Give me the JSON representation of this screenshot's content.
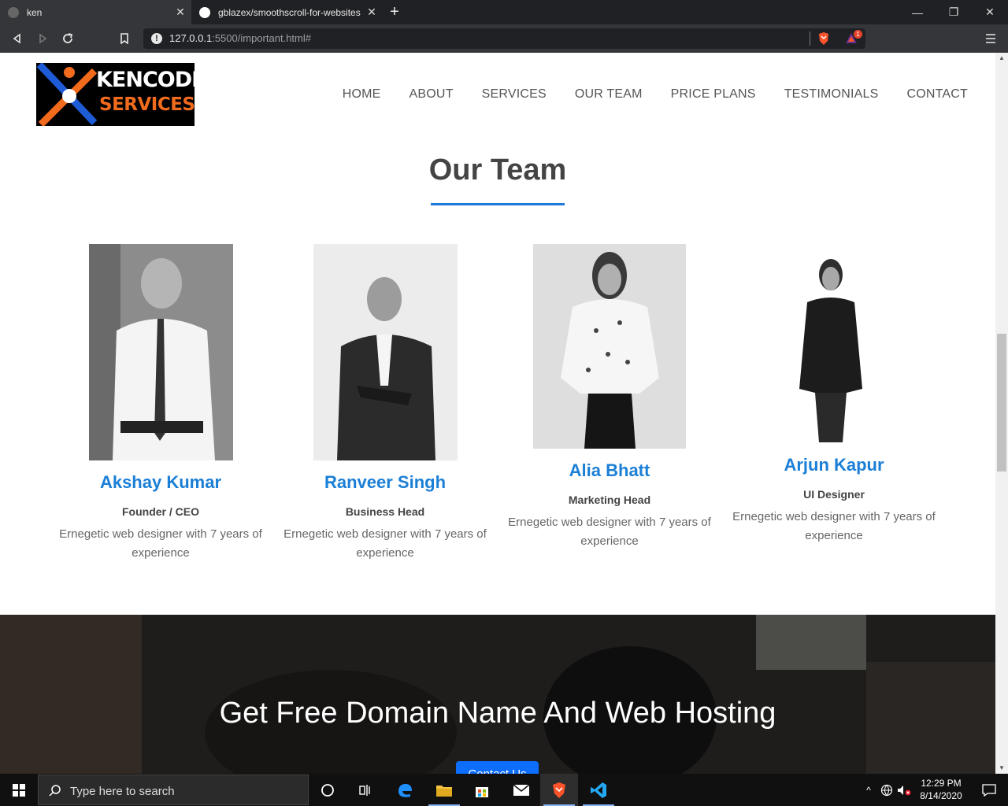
{
  "browser": {
    "tabs": [
      {
        "title": "ken",
        "active": true
      },
      {
        "title": "gblazex/smoothscroll-for-websites",
        "active": false
      }
    ],
    "url_host": "127.0.0.1",
    "url_rest": ":5500/important.html#",
    "brave_badge": "1"
  },
  "site": {
    "logo": {
      "line1": "KENCODE",
      "line2": "SERVICES"
    },
    "nav": [
      "HOME",
      "ABOUT",
      "SERVICES",
      "OUR TEAM",
      "PRICE PLANS",
      "TESTIMONIALS",
      "CONTACT"
    ],
    "section_title": "Our Team",
    "team": [
      {
        "name": "Akshay Kumar",
        "role": "Founder / CEO",
        "desc": "Ernegetic web designer with 7 years of experience"
      },
      {
        "name": "Ranveer Singh",
        "role": "Business Head",
        "desc": "Ernegetic web designer with 7 years of experience"
      },
      {
        "name": "Alia Bhatt",
        "role": "Marketing Head",
        "desc": "Ernegetic web designer with 7 years of experience"
      },
      {
        "name": "Arjun Kapur",
        "role": "UI Designer",
        "desc": "Ernegetic web designer with 7 years of experience"
      }
    ],
    "banner": {
      "title": "Get Free Domain Name And Web Hosting",
      "button": "Contact Us"
    }
  },
  "taskbar": {
    "search_placeholder": "Type here to search",
    "time": "12:29 PM",
    "date": "8/14/2020"
  },
  "colors": {
    "accent": "#1b7fd6",
    "logo_orange": "#f26b1d",
    "logo_blue": "#1e5bd6"
  }
}
